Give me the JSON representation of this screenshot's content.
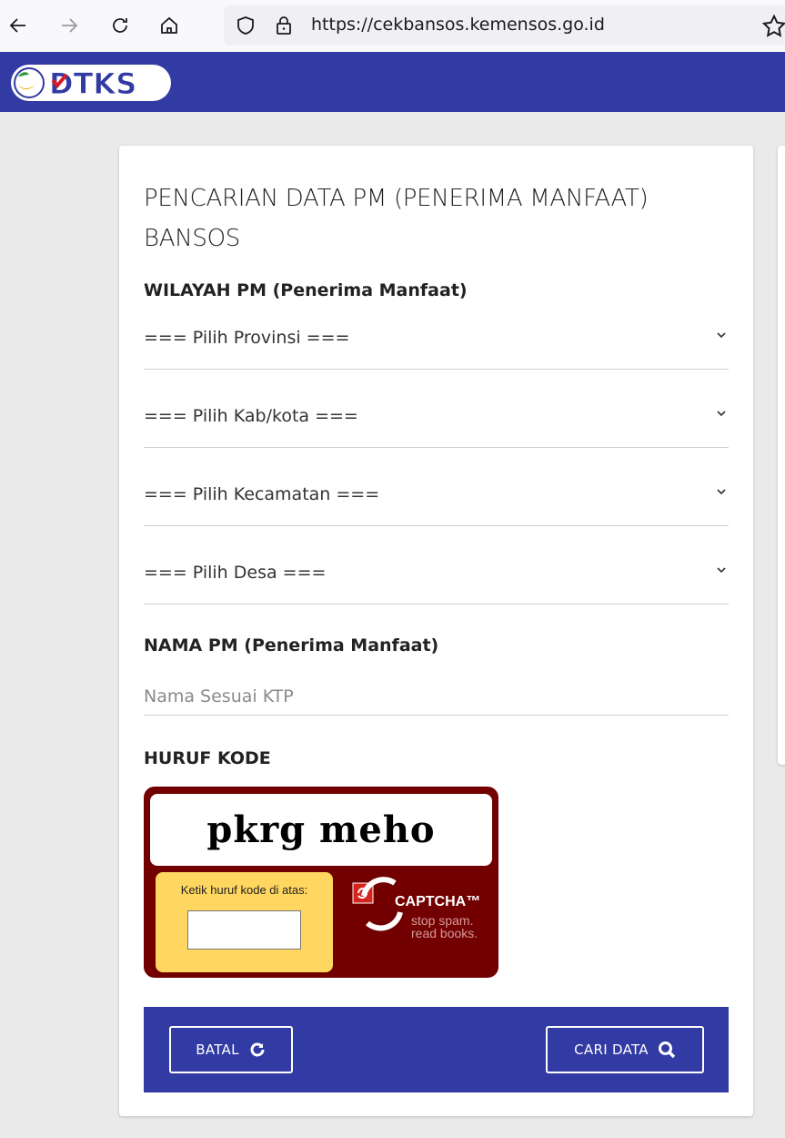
{
  "browser": {
    "url": "https://cekbansos.kemensos.go.id"
  },
  "header": {
    "logo_text": "DTKS"
  },
  "form": {
    "title": "PENCARIAN DATA PM (PENERIMA MANFAAT) BANSOS",
    "wilayah_label": "WILAYAH PM (Penerima Manfaat)",
    "selects": [
      {
        "value": "=== Pilih Provinsi ==="
      },
      {
        "value": "=== Pilih Kab/kota ==="
      },
      {
        "value": "=== Pilih Kecamatan ==="
      },
      {
        "value": "=== Pilih Desa ==="
      }
    ],
    "nama_label": "NAMA PM (Penerima Manfaat)",
    "nama_placeholder": "Nama Sesuai KTP",
    "nama_value": "",
    "kode_label": "HURUF KODE"
  },
  "captcha": {
    "challenge_text": "pkrg meho",
    "prompt": "Ketik huruf kode di atas:",
    "input_value": "",
    "brand": "CAPTCHA™",
    "tagline_line1": "stop spam.",
    "tagline_line2": "read books."
  },
  "actions": {
    "batal_label": "BATAL",
    "cari_label": "CARI DATA"
  },
  "colors": {
    "brand_blue": "#323aa3",
    "captcha_red": "#720000",
    "captcha_yellow": "#ffd760"
  }
}
